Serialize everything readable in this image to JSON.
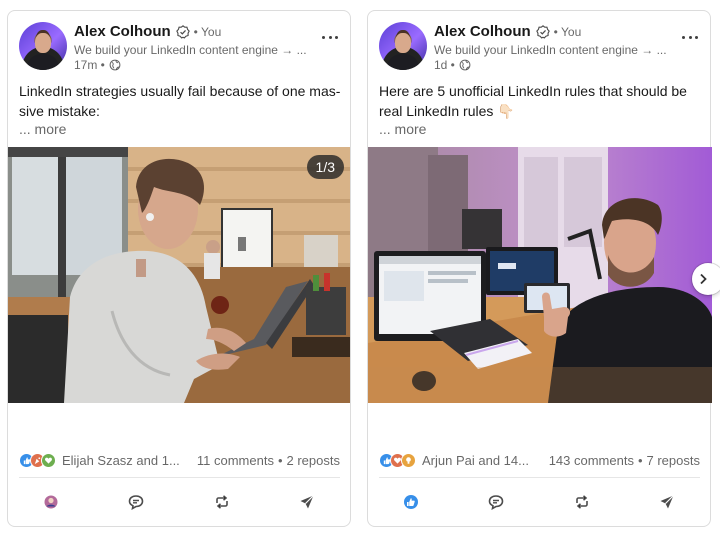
{
  "colors": {
    "like_blue": "#0a66c2",
    "celebrate_green": "#44712e",
    "love_red": "#df704d",
    "insight_yellow": "#e7a33e",
    "muted_text": "#666666"
  },
  "posts": [
    {
      "author": {
        "name": "Alex Colhoun",
        "connection": "• You",
        "tagline": "We build your LinkedIn content engine → ...",
        "time": "17m •"
      },
      "text": "LinkedIn strategies usually fail because of one mas-sive mistake:",
      "see_more": "... more",
      "media": {
        "type": "carousel",
        "counter": "1/3",
        "icon": "photo"
      },
      "social": {
        "reaction_icons": [
          "like-icon",
          "celebrate-icon",
          "love-icon"
        ],
        "reactors": "Elijah Szasz and 1...",
        "comments": "11 comments",
        "separator": "•",
        "reposts": "2 reposts"
      },
      "actions": [
        {
          "icon": "reaction-avatar-icon",
          "label": "React"
        },
        {
          "icon": "comment-icon",
          "label": "Comment"
        },
        {
          "icon": "repost-icon",
          "label": "Repost"
        },
        {
          "icon": "send-icon",
          "label": "Send"
        }
      ]
    },
    {
      "author": {
        "name": "Alex Colhoun",
        "connection": "• You",
        "tagline": "We build your LinkedIn content engine → ...",
        "time": "1d •"
      },
      "text": "Here are 5 unofficial LinkedIn rules that should be real LinkedIn rules 👇🏻",
      "see_more": "... more",
      "media": {
        "type": "photo",
        "icon": "photo"
      },
      "social": {
        "reaction_icons": [
          "like-icon",
          "love-icon",
          "insight-icon"
        ],
        "reactors": "Arjun Pai and 14...",
        "comments": "143 comments",
        "separator": "•",
        "reposts": "7 reposts"
      },
      "actions": [
        {
          "icon": "like-filled-icon",
          "label": "Like"
        },
        {
          "icon": "comment-icon",
          "label": "Comment"
        },
        {
          "icon": "repost-icon",
          "label": "Repost"
        },
        {
          "icon": "send-icon",
          "label": "Send"
        }
      ]
    }
  ],
  "next_arrow": {
    "icon": "chevron-right-icon"
  }
}
